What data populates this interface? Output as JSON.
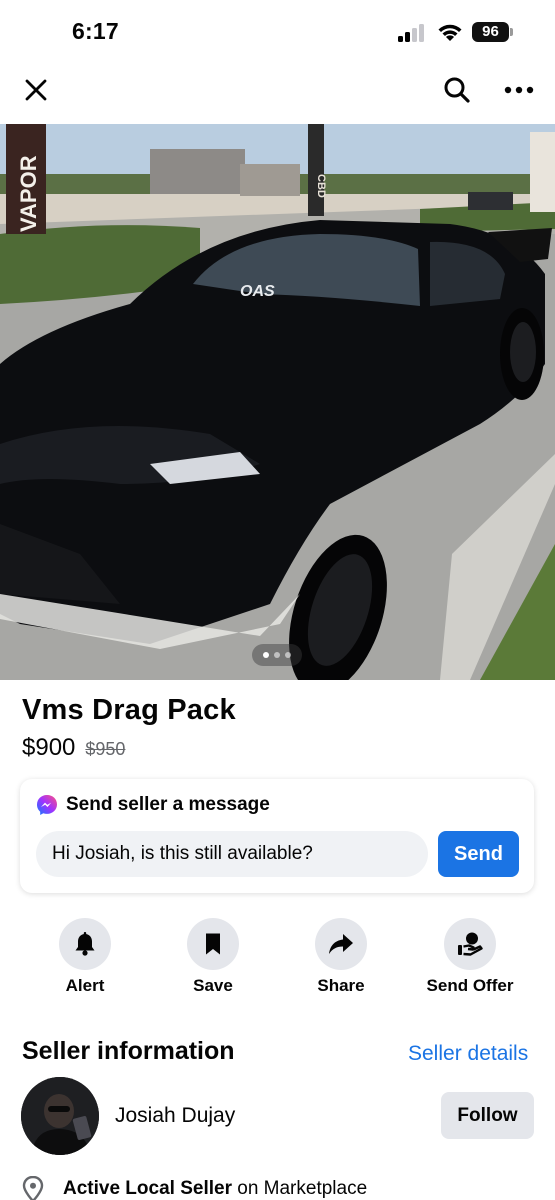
{
  "status": {
    "time": "6:17",
    "battery": "96"
  },
  "listing": {
    "title": "Vms Drag Pack",
    "price": "$900",
    "old_price": "$950",
    "photo_count": 3,
    "active_photo": 1
  },
  "photo_text": {
    "sign_left": "VAPOR",
    "sign_mid": "CBD",
    "windshield": "OAS"
  },
  "message": {
    "heading": "Send seller a message",
    "input_value": "Hi Josiah, is this still available?",
    "send_label": "Send"
  },
  "actions": [
    {
      "label": "Alert",
      "icon": "bell-icon"
    },
    {
      "label": "Save",
      "icon": "bookmark-icon"
    },
    {
      "label": "Share",
      "icon": "share-arrow-icon"
    },
    {
      "label": "Send Offer",
      "icon": "offer-hand-icon"
    }
  ],
  "seller": {
    "heading": "Seller information",
    "details_link": "Seller details",
    "name": "Josiah Dujay",
    "follow_label": "Follow",
    "badge_bold": "Active Local Seller",
    "badge_rest": " on Marketplace"
  },
  "colors": {
    "accent": "#1b74e4",
    "button_grey": "#e4e6eb"
  }
}
